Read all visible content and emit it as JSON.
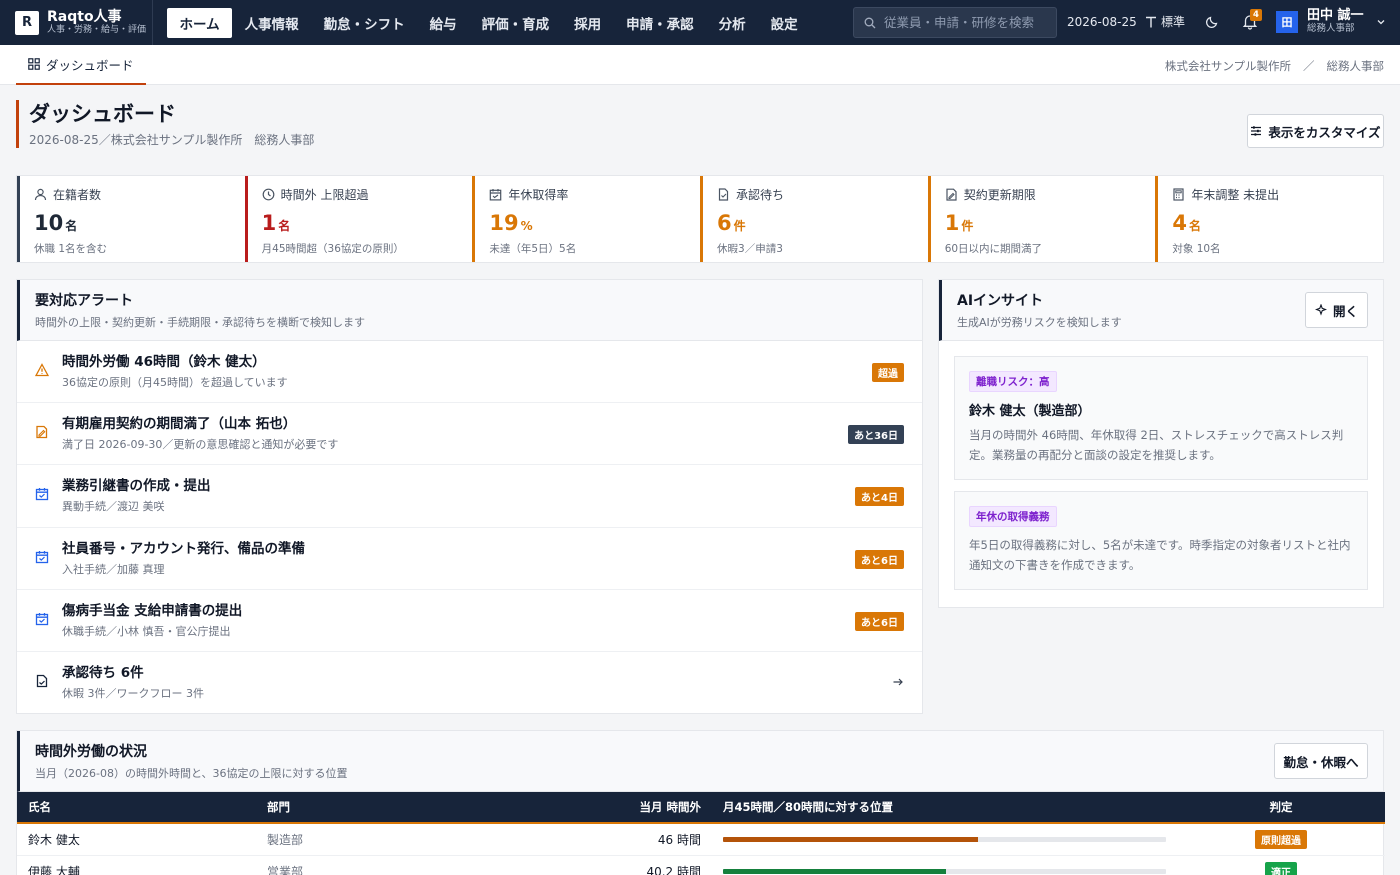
{
  "brand": {
    "logo": "R",
    "name": "Raqto人事",
    "sub": "人事・労務・給与・評価"
  },
  "nav": [
    "ホーム",
    "人事情報",
    "勤怠・シフト",
    "給与",
    "評価・育成",
    "採用",
    "申請・承認",
    "分析",
    "設定"
  ],
  "search": {
    "placeholder": "従業員・申請・研修を検索"
  },
  "top": {
    "date": "2026-08-25",
    "font_size": "標準",
    "notification_count": "4"
  },
  "user": {
    "initial": "田",
    "name": "田中 誠一",
    "dept": "総務人事部"
  },
  "subnav": {
    "tab": "ダッシュボード",
    "breadcrumb": [
      "株式会社サンプル製作所",
      "／",
      "総務人事部"
    ]
  },
  "page": {
    "title": "ダッシュボード",
    "subtitle": "2026-08-25／株式会社サンプル製作所　総務人事部",
    "customize_label": "表示をカスタマイズ"
  },
  "kpis": [
    {
      "icon": "user-icon",
      "label": "在籍者数",
      "value": "10",
      "unit": "名",
      "note": "休職 1名を含む",
      "color": "#1f2937",
      "accent": "#334155"
    },
    {
      "icon": "clock-icon",
      "label": "時間外 上限超過",
      "value": "1",
      "unit": "名",
      "note": "月45時間超（36協定の原則）",
      "color": "#b91c1c",
      "accent": "#b91c1c"
    },
    {
      "icon": "calendar-icon",
      "label": "年休取得率",
      "value": "19",
      "unit": "%",
      "note": "未達（年5日）5名",
      "color": "#d97706",
      "accent": "#d97706"
    },
    {
      "icon": "document-icon",
      "label": "承認待ち",
      "value": "6",
      "unit": "件",
      "note": "休暇3／申請3",
      "color": "#d97706",
      "accent": "#d97706"
    },
    {
      "icon": "contract-icon",
      "label": "契約更新期限",
      "value": "1",
      "unit": "件",
      "note": "60日以内に期間満了",
      "color": "#d97706",
      "accent": "#d97706"
    },
    {
      "icon": "calculator-icon",
      "label": "年末調整 未提出",
      "value": "4",
      "unit": "名",
      "note": "対象 10名",
      "color": "#d97706",
      "accent": "#d97706"
    }
  ],
  "alerts": {
    "title": "要対応アラート",
    "subtitle": "時間外の上限・契約更新・手続期限・承認待ちを横断で検知します",
    "items": [
      {
        "icon": "warning-icon",
        "title": "時間外労働 46時間（鈴木 健太）",
        "sub": "36協定の原則（月45時間）を超過しています",
        "tag": "超過",
        "tag_style": "orange"
      },
      {
        "icon": "edit-doc-icon",
        "title": "有期雇用契約の期間満了（山本 拓也）",
        "sub": "満了日 2026-09-30／更新の意思確認と通知が必要です",
        "tag": "あと36日",
        "tag_style": "dark"
      },
      {
        "icon": "calendar-check-icon",
        "title": "業務引継書の作成・提出",
        "sub": "異動手続／渡辺 美咲",
        "tag": "あと4日",
        "tag_style": "orange"
      },
      {
        "icon": "calendar-check-icon",
        "title": "社員番号・アカウント発行、備品の準備",
        "sub": "入社手続／加藤 真理",
        "tag": "あと6日",
        "tag_style": "orange"
      },
      {
        "icon": "calendar-check-icon",
        "title": "傷病手当金 支給申請書の提出",
        "sub": "休職手続／小林 慎吾・官公庁提出",
        "tag": "あと6日",
        "tag_style": "orange"
      },
      {
        "icon": "approval-doc-icon",
        "title": "承認待ち 6件",
        "sub": "休暇 3件／ワークフロー 3件",
        "tag": "",
        "tag_style": "arrow"
      }
    ]
  },
  "ai": {
    "title": "AIインサイト",
    "subtitle": "生成AIが労務リスクを検知します",
    "open_label": "開く",
    "cards": [
      {
        "pill": "離職リスク：高",
        "title": "鈴木 健太（製造部）",
        "text": "当月の時間外 46時間、年休取得 2日、ストレスチェックで高ストレス判定。業務量の再配分と面談の設定を推奨します。"
      },
      {
        "pill": "年休の取得義務",
        "title": "",
        "text": "年5日の取得義務に対し、5名が未達です。時季指定の対象者リストと社内通知文の下書きを作成できます。"
      }
    ]
  },
  "overtime": {
    "title": "時間外労働の状況",
    "subtitle": "当月（2026-08）の時間外時間と、36協定の上限に対する位置",
    "button": "勤怠・休暇へ",
    "headers": [
      "氏名",
      "部門",
      "当月 時間外",
      "月45時間／80時間に対する位置",
      "判定"
    ],
    "rows": [
      {
        "name": "鈴木 健太",
        "dept": "製造部",
        "hours": "46 時間",
        "ratio": 0.575,
        "bar_color": "#b45309",
        "judge": "原則超過",
        "judge_color": "#d97706"
      },
      {
        "name": "伊藤 大輔",
        "dept": "営業部",
        "hours": "40.2 時間",
        "ratio": 0.5025,
        "bar_color": "#15803d",
        "judge": "適正",
        "judge_color": "#16a34a"
      }
    ]
  }
}
